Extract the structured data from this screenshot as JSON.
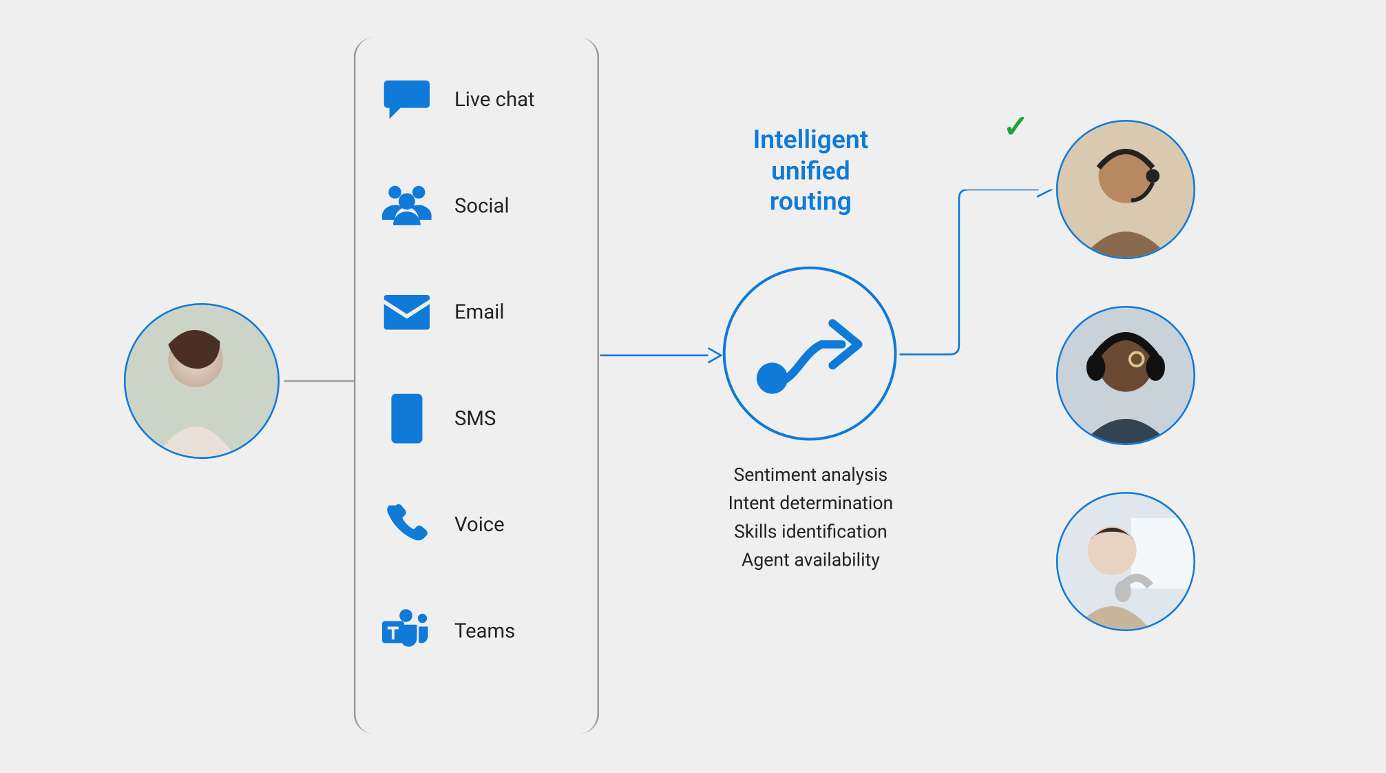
{
  "colors": {
    "brand": "#0f7ad8",
    "accent_ok": "#1ba63a",
    "bracket": "#999",
    "bg": "#efefef"
  },
  "customer": {
    "alt": "Customer on phone"
  },
  "channels": [
    {
      "icon": "chat-icon",
      "label": "Live chat"
    },
    {
      "icon": "people-icon",
      "label": "Social"
    },
    {
      "icon": "mail-icon",
      "label": "Email"
    },
    {
      "icon": "sms-icon",
      "label": "SMS"
    },
    {
      "icon": "phone-icon",
      "label": "Voice"
    },
    {
      "icon": "teams-icon",
      "label": "Teams"
    }
  ],
  "routing": {
    "title_line1": "Intelligent",
    "title_line2": "unified",
    "title_line3": "routing",
    "capabilities": [
      "Sentiment analysis",
      "Intent determination",
      "Skills identification",
      "Agent availability"
    ]
  },
  "agents": [
    {
      "alt": "Agent with headset (selected)",
      "selected": true
    },
    {
      "alt": "Agent with headphones",
      "selected": false
    },
    {
      "alt": "Agent at screen",
      "selected": false
    }
  ],
  "checkmark": "✓"
}
